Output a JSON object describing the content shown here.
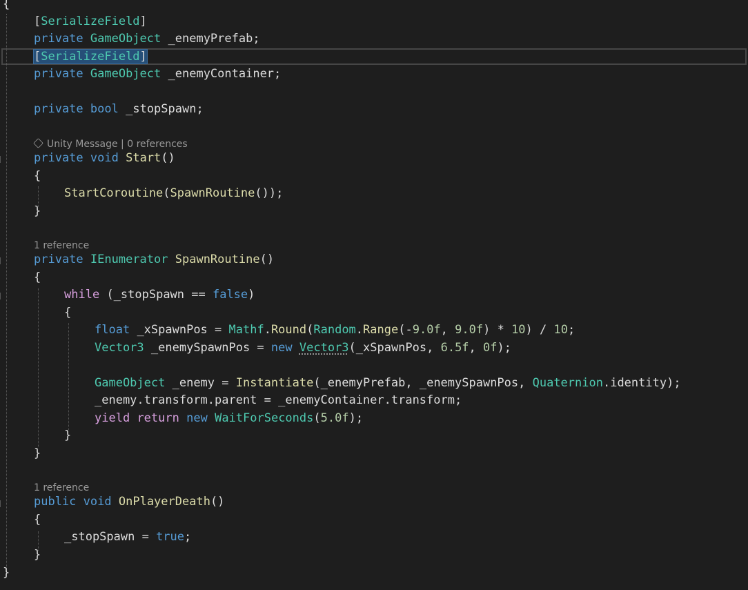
{
  "lines": [
    "{",
    "[SerializeField]",
    "private GameObject _enemyPrefab;",
    "[SerializeField]",
    "private GameObject _enemyContainer;",
    "private bool _stopSpawn;",
    "private void Start()",
    "{",
    "StartCoroutine(SpawnRoutine());",
    "}",
    "private IEnumerator SpawnRoutine()",
    "{",
    "while (_stopSpawn == false)",
    "{",
    "float _xSpawnPos = Mathf.Round(Random.Range(-9.0f, 9.0f) * 10) / 10;",
    "Vector3 _enemySpawnPos = new Vector3(_xSpawnPos, 6.5f, 0f);",
    "GameObject _enemy = Instantiate(_enemyPrefab, _enemySpawnPos, Quaternion.identity);",
    "_enemy.transform.parent = _enemyContainer.transform;",
    "yield return new WaitForSeconds(5.0f);",
    "}",
    "}",
    "public void OnPlayerDeath()",
    "{",
    "_stopSpawn = true;",
    "}",
    "}"
  ],
  "codelens": {
    "start": "Unity Message | 0 references",
    "spawn_routine": "1 reference",
    "on_player_death": "1 reference"
  },
  "colors": {
    "background": "#1e1e1e",
    "keyword": "#569cd6",
    "type": "#4ec9b0",
    "method": "#dcdcaa",
    "control": "#d8a0df",
    "number": "#b5cea8",
    "text": "#dcdcdc",
    "selection": "#264f78"
  }
}
